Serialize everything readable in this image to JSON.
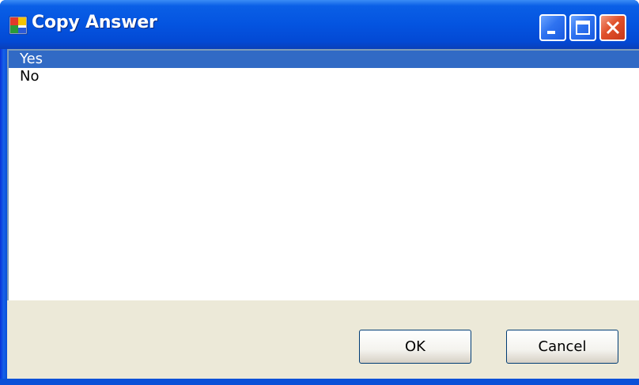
{
  "window": {
    "title": "Copy Answer",
    "icon": "application-window-icon",
    "controls": [
      "minimize-icon",
      "maximize-icon",
      "close-icon"
    ]
  },
  "list": {
    "items": [
      {
        "label": "Yes",
        "selected": true
      },
      {
        "label": "No",
        "selected": false
      }
    ]
  },
  "buttons": {
    "ok_label": "OK",
    "cancel_label": "Cancel"
  },
  "colors": {
    "titlebar": "#0454e0",
    "selection": "#316ac5",
    "client_bg": "#ece9d8",
    "close_button": "#e0502a"
  }
}
